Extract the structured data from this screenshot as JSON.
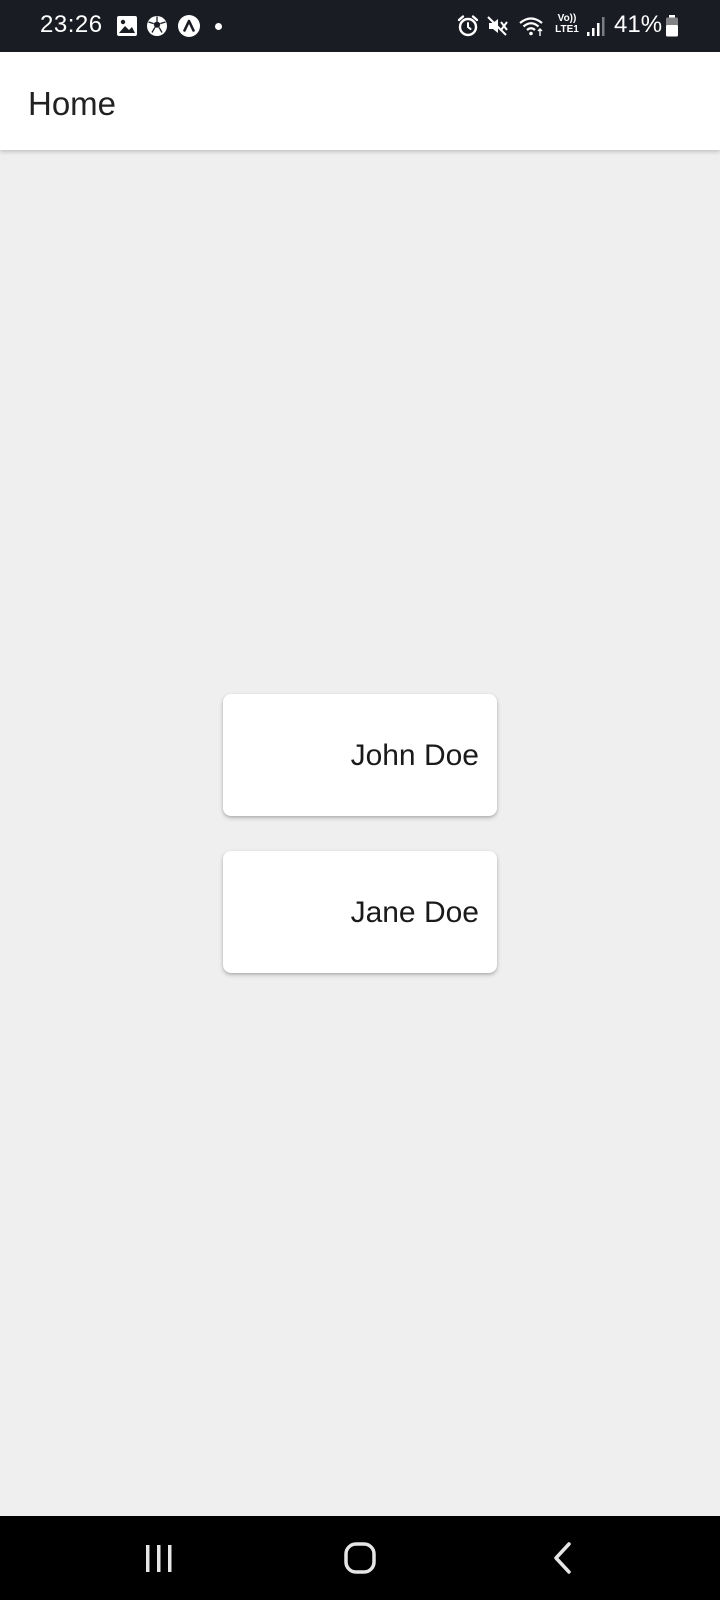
{
  "status_bar": {
    "time": "23:26",
    "icons_left": [
      "gallery-icon",
      "soccer-ball-icon",
      "app-notification-icon",
      "more-notifications-dot"
    ],
    "icons_right": [
      "alarm-icon",
      "mute-icon",
      "wifi-icon",
      "volte-icon",
      "signal-icon",
      "battery-icon"
    ],
    "volte_top": "Vo))",
    "volte_bottom": "LTE1",
    "battery": "41%"
  },
  "app_bar": {
    "title": "Home"
  },
  "cards": [
    {
      "name": "John Doe"
    },
    {
      "name": "Jane Doe"
    }
  ],
  "nav_bar": {
    "buttons": [
      "recents-icon",
      "home-icon",
      "back-icon"
    ]
  },
  "colors": {
    "status_bar_bg": "#1a1c24",
    "app_bar_bg": "#ffffff",
    "page_bg": "#efefef",
    "card_bg": "#ffffff",
    "nav_bar_bg": "#000000"
  }
}
